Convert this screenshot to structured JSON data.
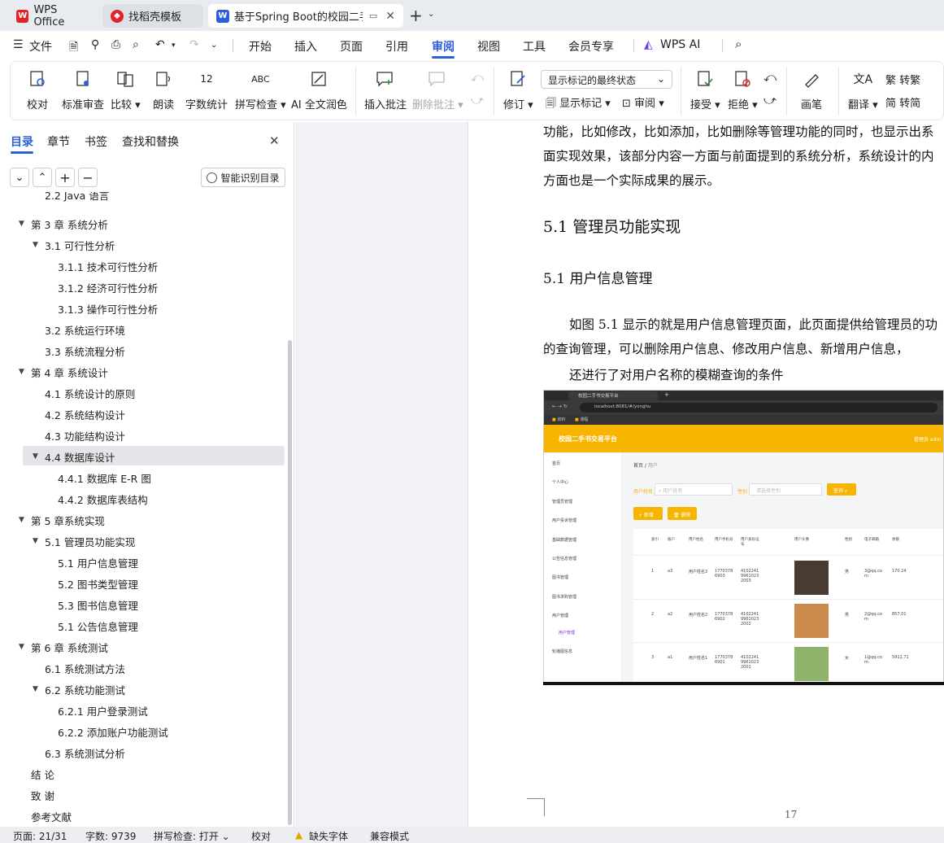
{
  "tabs": [
    {
      "label": "WPS Office"
    },
    {
      "label": "找稻壳模板"
    },
    {
      "label": "基于Spring Boot的校园二手"
    }
  ],
  "menu": [
    "文件",
    "开始",
    "插入",
    "页面",
    "引用",
    "审阅",
    "视图",
    "工具",
    "会员专享",
    "WPS AI"
  ],
  "ribbon": {
    "proof": "校对",
    "std_review": "标准审查",
    "compare": "比较",
    "read": "朗读",
    "word_count": "字数统计",
    "spell": "拼写检查",
    "ai_polish": "AI 全文润色",
    "insert_comment": "插入批注",
    "delete_comment": "删除批注",
    "track": "修订",
    "markup_select": "显示标记的最终状态",
    "show_markup": "显示标记",
    "review": "审阅",
    "accept": "接受",
    "reject": "拒绝",
    "pen": "画笔",
    "translate": "翻译",
    "to_trad": "转繁",
    "to_simp": "转简"
  },
  "panel": {
    "tabs": [
      "目录",
      "章节",
      "书签",
      "查找和替换"
    ],
    "smart_toc": "智能识别目录"
  },
  "toc": [
    {
      "label": "2.2 Java 语言",
      "level": 2,
      "arrow": false
    },
    {
      "label": "第 3 章  系统分析",
      "level": 1,
      "arrow": true
    },
    {
      "label": "3.1 可行性分析",
      "level": 2,
      "arrow": true
    },
    {
      "label": "3.1.1 技术可行性分析",
      "level": 3,
      "arrow": false
    },
    {
      "label": "3.1.2 经济可行性分析",
      "level": 3,
      "arrow": false
    },
    {
      "label": "3.1.3 操作可行性分析",
      "level": 3,
      "arrow": false
    },
    {
      "label": "3.2 系统运行环境",
      "level": 2,
      "arrow": false
    },
    {
      "label": "3.3 系统流程分析",
      "level": 2,
      "arrow": false
    },
    {
      "label": "第 4 章  系统设计",
      "level": 1,
      "arrow": true
    },
    {
      "label": "4.1  系统设计的原则",
      "level": 2,
      "arrow": false
    },
    {
      "label": "4.2  系统结构设计",
      "level": 2,
      "arrow": false
    },
    {
      "label": "4.3 功能结构设计",
      "level": 2,
      "arrow": false
    },
    {
      "label": "4.4 数据库设计",
      "level": 2,
      "arrow": true,
      "selected": true
    },
    {
      "label": "4.4.1  数据库 E-R 图",
      "level": 3,
      "arrow": false
    },
    {
      "label": "4.4.2  数据库表结构",
      "level": 3,
      "arrow": false
    },
    {
      "label": "第 5 章系统实现",
      "level": 1,
      "arrow": true
    },
    {
      "label": "5.1 管理员功能实现",
      "level": 2,
      "arrow": true
    },
    {
      "label": "5.1 用户信息管理",
      "level": 3,
      "arrow": false
    },
    {
      "label": "5.2  图书类型管理",
      "level": 3,
      "arrow": false
    },
    {
      "label": "5.3 图书信息管理",
      "level": 3,
      "arrow": false
    },
    {
      "label": "5.1 公告信息管理",
      "level": 3,
      "arrow": false
    },
    {
      "label": "第 6 章  系统测试",
      "level": 1,
      "arrow": true
    },
    {
      "label": "6.1 系统测试方法",
      "level": 2,
      "arrow": false
    },
    {
      "label": "6.2  系统功能测试",
      "level": 2,
      "arrow": true
    },
    {
      "label": "6.2.1  用户登录测试",
      "level": 3,
      "arrow": false
    },
    {
      "label": "6.2.2  添加账户功能测试",
      "level": 3,
      "arrow": false
    },
    {
      "label": "6.3  系统测试分析",
      "level": 2,
      "arrow": false
    },
    {
      "label": "结    论",
      "level": 1,
      "arrow": false
    },
    {
      "label": "致    谢",
      "level": 1,
      "arrow": false
    },
    {
      "label": "参考文献",
      "level": 1,
      "arrow": false
    }
  ],
  "doc": {
    "p1": "功能，比如修改，比如添加，比如删除等管理功能的同时，也显示出系",
    "p2": "面实现效果，该部分内容一方面与前面提到的系统分析，系统设计的内",
    "p3": "方面也是一个实际成果的展示。",
    "h1": "5.1 管理员功能实现",
    "h2": "5.1 用户信息管理",
    "p4": "如图 5.1 显示的就是用户信息管理页面，此页面提供给管理员的功",
    "p5": "的查询管理，可以删除用户信息、修改用户信息、新增用户信息，",
    "p6": "还进行了对用户名称的模糊查询的条件",
    "page_no": "17"
  },
  "shot": {
    "tab": "校园二手书交易平台",
    "url": "localhost:8081/#/yonghu",
    "bm1": "资料",
    "bm2": "课程",
    "title": "校园二手书交易平台",
    "admin": "管理员 adm",
    "menu": [
      "首页",
      "个人中心",
      "管理员管理",
      "用户投诉管理",
      "基础数据管理",
      "公告信息管理",
      "图书管理",
      "图书求购管理",
      "用户管理",
      "用户管理",
      "轮播图信息"
    ],
    "crumb1": "首页",
    "crumb2": "用户",
    "search_label1": "用户姓名",
    "search_ph1": "用户姓名",
    "search_label2": "性别",
    "search_ph2": "请选择性别",
    "search_btn": "查询",
    "add_btn": "+ 新增",
    "del_btn": "删除",
    "headers": [
      "索引",
      "账户",
      "用户姓名",
      "用户手机号",
      "用户身份证号",
      "用户头像",
      "性别",
      "电子邮箱",
      "余额"
    ],
    "rows": [
      {
        "idx": "1",
        "acct": "a3",
        "name": "用户姓名3",
        "phone": "17703786903",
        "id": "410224199610232003",
        "sex": "男",
        "email": "3@qq.com",
        "bal": "170.24"
      },
      {
        "idx": "2",
        "acct": "a2",
        "name": "用户姓名2",
        "phone": "17703786902",
        "id": "410224199610232002",
        "sex": "男",
        "email": "2@qq.com",
        "bal": "857.01"
      },
      {
        "idx": "3",
        "acct": "a1",
        "name": "用户姓名1",
        "phone": "17703786901",
        "id": "410224199610232001",
        "sex": "女",
        "email": "1@qq.com",
        "bal": "5911.71"
      }
    ]
  },
  "status": {
    "page": "页面: 21/31",
    "words": "字数: 9739",
    "spell": "拼写检查: 打开",
    "proof": "校对",
    "missing_font": "缺失字体",
    "compat": "兼容模式"
  },
  "colors": {
    "accent": "#2b5fd9",
    "wps_red": "#e0242a",
    "selected_row": "#e3e5e8",
    "brand_yellow": "#f7b500"
  }
}
